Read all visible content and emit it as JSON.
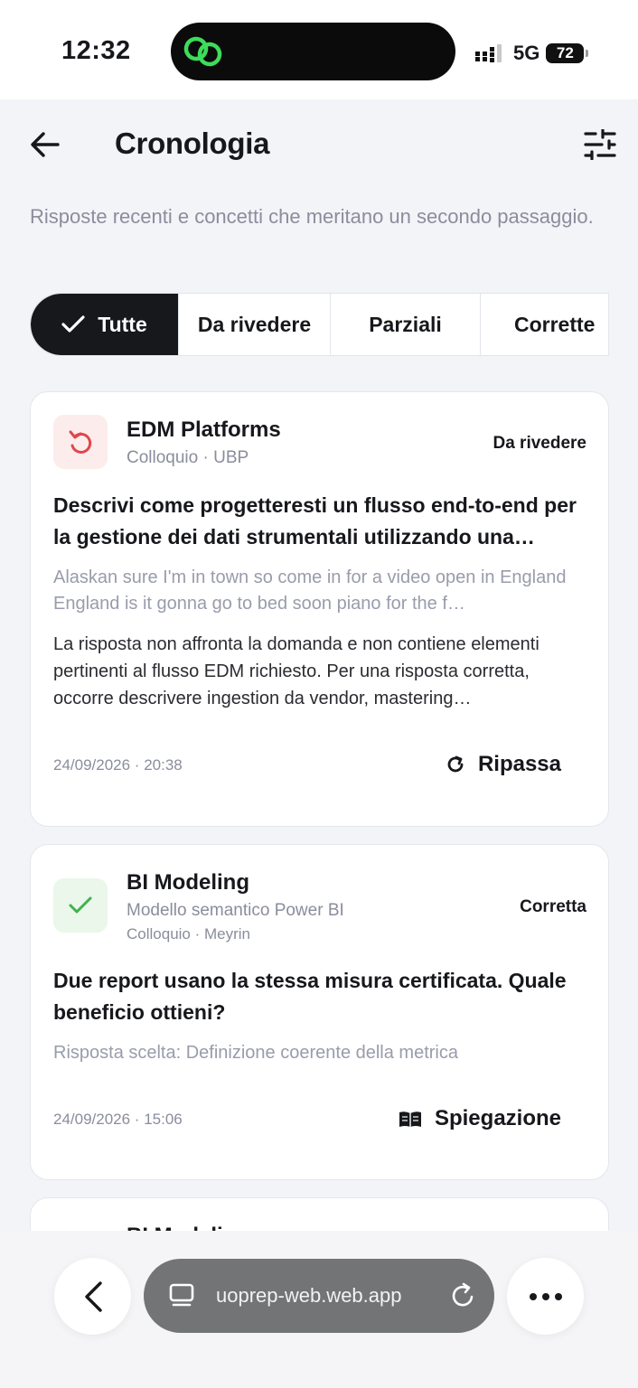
{
  "status_bar": {
    "time": "12:32",
    "network": "5G",
    "battery": "72",
    "island_app_icon": "linked-rings-icon",
    "island_app_color": "#3ddc5a"
  },
  "header": {
    "title": "Cronologia",
    "back_icon": "arrow-left-icon",
    "filter_icon": "sliders-icon"
  },
  "subtitle": "Risposte recenti e concetti che meritano un secondo passaggio.",
  "tabs": [
    {
      "label": "Tutte",
      "active": true
    },
    {
      "label": "Da rivedere",
      "active": false
    },
    {
      "label": "Parziali",
      "active": false
    },
    {
      "label": "Corrette",
      "active": false
    }
  ],
  "cards": [
    {
      "title": "EDM Platforms",
      "subtitle": "Colloquio · UBP",
      "badge": "Da rivedere",
      "icon": "undo-arrow-icon",
      "icon_color": "#e0464b",
      "icon_bg": "#fdecec",
      "question": "Descrivi come progetteresti un flusso end-to-end per la gestione dei dati strumentali utilizzando una piattaforma EDM.",
      "answer": "Alaskan sure I'm in town so come in for a video open in England England is it gonna go to bed soon piano for the f…",
      "feedback": "La risposta non affronta la domanda e non contiene elementi pertinenti al flusso EDM richiesto. Per una risposta corretta, occorre descrivere ingestion da vendor, mastering…",
      "date": "24/09/2026 · 20:38",
      "action": "Ripassa",
      "action_icon": "refresh-icon"
    },
    {
      "title": "BI Modeling",
      "subtitle": "Modello semantico Power BI",
      "subtitle2": "Colloquio · Meyrin",
      "badge": "Corretta",
      "icon": "check-icon",
      "icon_color": "#3fb24f",
      "icon_bg": "#eaf7ea",
      "question": "Due report usano la stessa misura certificata. Quale beneficio ottieni?",
      "answer": "Risposta scelta: Definizione coerente della metrica",
      "date": "24/09/2026 · 15:06",
      "action": "Spiegazione",
      "action_icon": "book-icon"
    },
    {
      "title": "BI Modeling"
    }
  ],
  "browser": {
    "url": "uoprep-web.web.app"
  }
}
